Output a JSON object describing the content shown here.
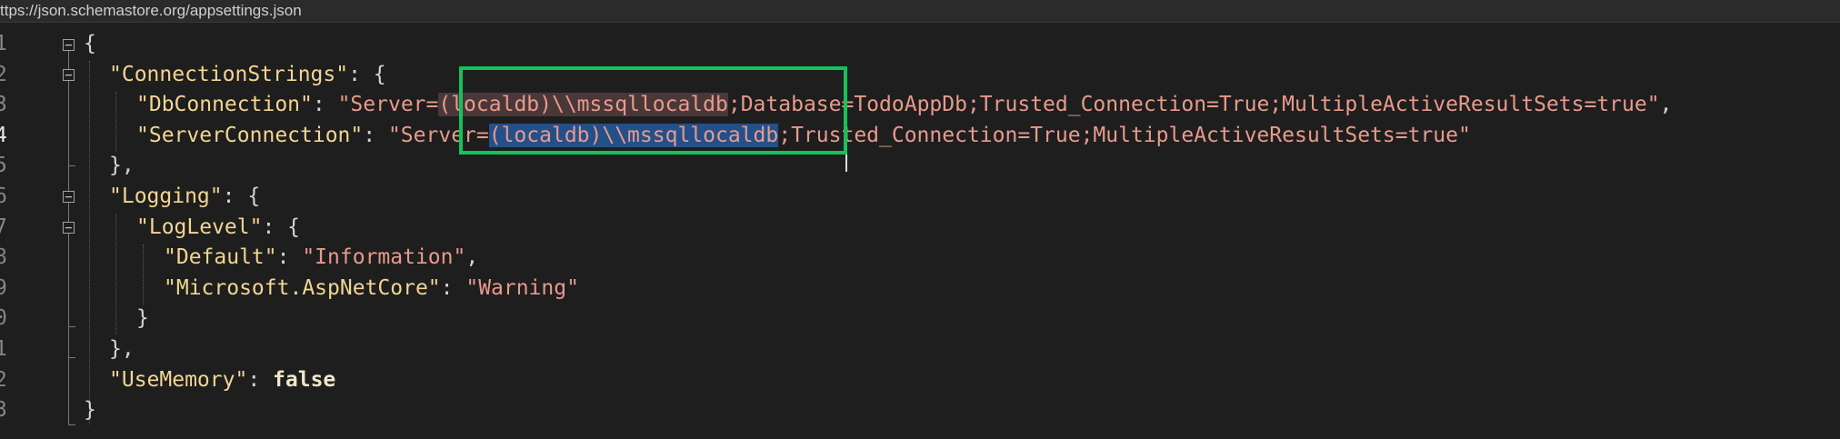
{
  "schema_url": "ttps://json.schemastore.org/appsettings.json",
  "line_numbers": [
    "1",
    "2",
    "3",
    "4",
    "5",
    "6",
    "7",
    "8",
    "9",
    "0",
    "1",
    "2",
    "3"
  ],
  "code": {
    "l1": {
      "brace": "{"
    },
    "l2": {
      "key": "\"ConnectionStrings\"",
      "punct": ": {"
    },
    "l3": {
      "key": "\"DbConnection\"",
      "colon": ": ",
      "pre": "\"Server=",
      "hl": "(localdb)\\\\mssqllocaldb",
      "post": ";Database=TodoAppDb;Trusted_Connection=True;MultipleActiveResultSets=true\"",
      "comma": ","
    },
    "l4": {
      "key": "\"ServerConnection\"",
      "colon": ": ",
      "pre": "\"Server=",
      "sel": "(localdb)\\\\mssqllocaldb",
      "post": ";Trusted_Connection=True;MultipleActiveResultSets=true\""
    },
    "l5": {
      "punct": "},"
    },
    "l6": {
      "key": "\"Logging\"",
      "punct": ": {"
    },
    "l7": {
      "key": "\"LogLevel\"",
      "punct": ": {"
    },
    "l8": {
      "key": "\"Default\"",
      "colon": ": ",
      "value": "\"Information\"",
      "comma": ","
    },
    "l9": {
      "key": "\"Microsoft.AspNetCore\"",
      "colon": ": ",
      "value": "\"Warning\""
    },
    "l10": {
      "punct": "}"
    },
    "l11": {
      "punct": "},"
    },
    "l12": {
      "key": "\"UseMemory\"",
      "colon": ": ",
      "value": "false"
    },
    "l13": {
      "brace": "}"
    }
  },
  "colors": {
    "background": "#1e1e1e",
    "key": "#f2d592",
    "string": "#e89a8c",
    "selection": "#24508a",
    "highlight_box": "#14c25a"
  }
}
